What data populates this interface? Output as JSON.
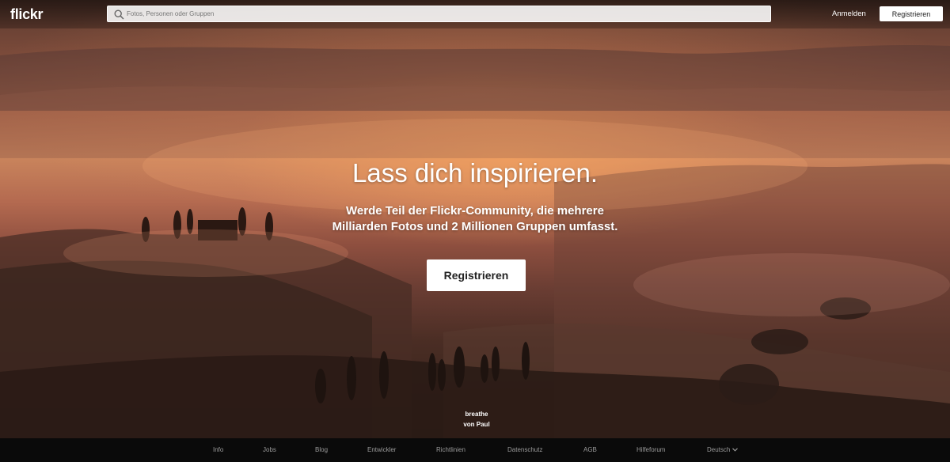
{
  "header": {
    "logo": "flickr",
    "search_placeholder": "Fotos, Personen oder Gruppen",
    "login_label": "Anmelden",
    "signup_label": "Registrieren"
  },
  "hero": {
    "headline": "Lass dich inspirieren.",
    "subline": "Werde Teil der Flickr-Community, die mehrere Milliarden Fotos und 2 Millionen Gruppen umfasst.",
    "cta_label": "Registrieren",
    "photo_title": "breathe",
    "photo_author": "von Paul"
  },
  "footer": {
    "links": [
      "Info",
      "Jobs",
      "Blog",
      "Entwickler",
      "Richtlinien",
      "Datenschutz",
      "AGB",
      "Hilfeforum"
    ],
    "language": "Deutsch"
  },
  "icons": {
    "search": "search-icon",
    "language_dropdown": "chevron-down-icon"
  }
}
